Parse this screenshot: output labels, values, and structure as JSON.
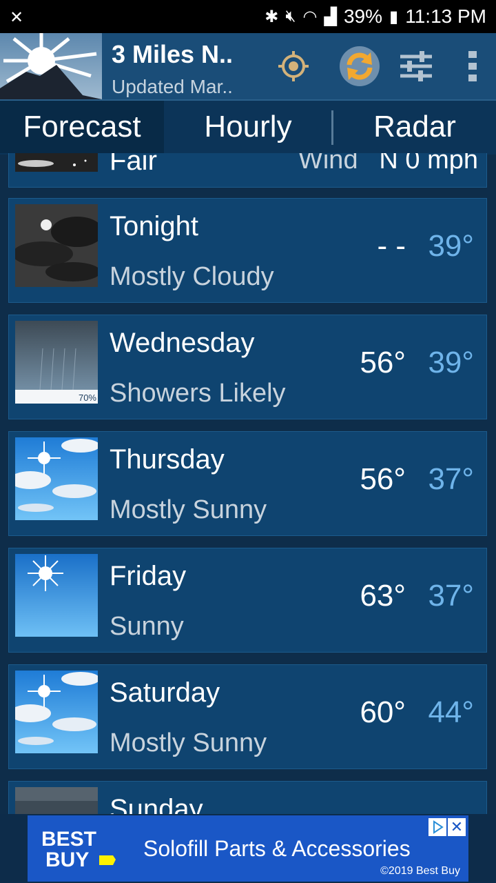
{
  "status_bar": {
    "battery": "39%",
    "time": "11:13 PM"
  },
  "header": {
    "location": "3 Miles N..",
    "updated": "Updated Mar.."
  },
  "tabs": [
    {
      "label": "Forecast",
      "selected": true
    },
    {
      "label": "Hourly",
      "selected": false
    },
    {
      "label": "Radar",
      "selected": false
    }
  ],
  "current": {
    "condition": "Fair",
    "wind_label": "Wind",
    "wind_value": "N 0 mph"
  },
  "forecast": [
    {
      "day": "Tonight",
      "condition": "Mostly Cloudy",
      "high": "- -",
      "low": "39°",
      "icon": "night-cloudy-icon"
    },
    {
      "day": "Wednesday",
      "condition": "Showers Likely",
      "high": "56°",
      "low": "39°",
      "precip": "70%",
      "icon": "showers-icon"
    },
    {
      "day": "Thursday",
      "condition": "Mostly Sunny",
      "high": "56°",
      "low": "37°",
      "icon": "mostly-sunny-icon"
    },
    {
      "day": "Friday",
      "condition": "Sunny",
      "high": "63°",
      "low": "37°",
      "icon": "sunny-icon"
    },
    {
      "day": "Saturday",
      "condition": "Mostly Sunny",
      "high": "60°",
      "low": "44°",
      "icon": "mostly-sunny-icon"
    },
    {
      "day": "Sunday",
      "condition": "",
      "high": "",
      "low": "",
      "icon": "cloudy-icon"
    }
  ],
  "ad": {
    "brand_line1": "BEST",
    "brand_line2": "BUY",
    "headline": "Solofill Parts & Accessories",
    "copyright": "©2019 Best Buy"
  },
  "colors": {
    "background": "#0e2d4a",
    "card": "#0f4470",
    "header": "#1a4d78",
    "low_temp": "#6fb4ea",
    "ad_blue": "#1a57c6",
    "ad_yellow": "#fff200"
  }
}
